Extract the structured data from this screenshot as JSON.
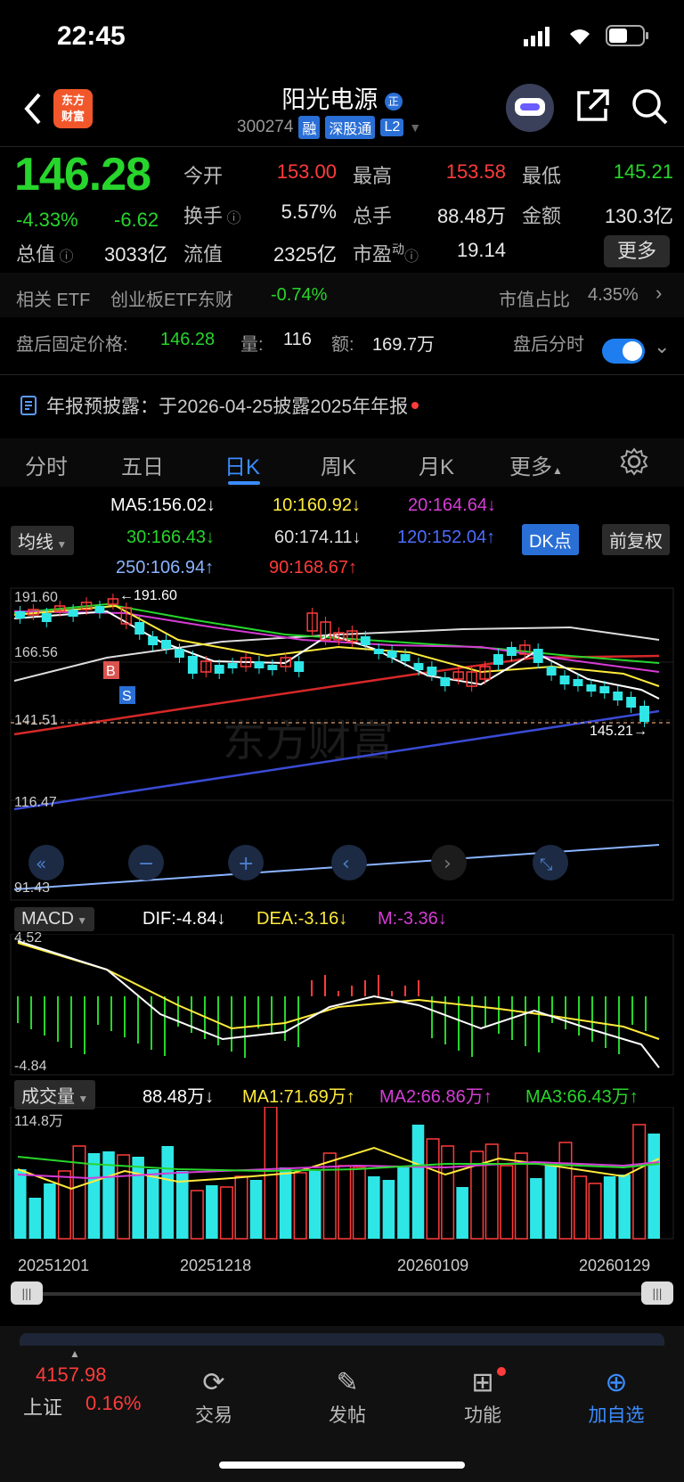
{
  "status": {
    "time": "22:45"
  },
  "header": {
    "logo_text_line1": "东方",
    "logo_text_line2": "财富",
    "name": "阳光电源",
    "badge": "正",
    "code": "300274",
    "tags": [
      "融",
      "深股通",
      "L2"
    ]
  },
  "quote": {
    "price": "146.28",
    "change_pct": "-4.33%",
    "change_abs": "-6.62",
    "fields": [
      {
        "label": "今开",
        "value": "153.00",
        "color": "red"
      },
      {
        "label": "最高",
        "value": "153.58",
        "color": "red"
      },
      {
        "label": "最低",
        "value": "145.21",
        "color": "green"
      },
      {
        "label": "换手",
        "value": "5.57%",
        "color": "white"
      },
      {
        "label": "总手",
        "value": "88.48万",
        "color": "white"
      },
      {
        "label": "金额",
        "value": "130.3亿",
        "color": "white"
      },
      {
        "label": "总值",
        "value": "3033亿",
        "color": "white"
      },
      {
        "label": "流值",
        "value": "2325亿",
        "color": "white"
      },
      {
        "label": "市盈",
        "value": "19.14",
        "color": "white"
      }
    ],
    "pe_superscript": "动",
    "more_label": "更多"
  },
  "etf": {
    "label": "相关 ETF",
    "name": "创业板ETF东财",
    "change": "-0.74%",
    "ratio_label": "市值占比",
    "ratio_value": "4.35%"
  },
  "after_hours": {
    "price_label": "盘后固定价格:",
    "price": "146.28",
    "vol_label": "量:",
    "vol": "116",
    "amt_label": "额:",
    "amt": "169.7万",
    "toggle_label": "盘后分时"
  },
  "notice": "年报预披露：于2026-04-25披露2025年年报",
  "tabs": [
    "分时",
    "五日",
    "日K",
    "周K",
    "月K",
    "更多"
  ],
  "indicators": {
    "ma_selector": "均线",
    "ma5": "MA5:156.02",
    "ma10": "10:160.92",
    "ma20": "20:164.64",
    "ma30": "30:166.43",
    "ma60": "60:174.11",
    "ma120": "120:152.04",
    "ma250": "250:106.94",
    "ma90": "90:168.67",
    "dk_button": "DK点",
    "fq_button": "前复权",
    "arrow_down": "↓",
    "arrow_up": "↑"
  },
  "price_axis": [
    "191.60",
    "166.56",
    "141.51",
    "116.47",
    "91.43"
  ],
  "annotations": {
    "high_mark": "191.60",
    "low_mark": "145.21"
  },
  "macd": {
    "selector": "MACD",
    "dif": "DIF:-4.84",
    "dea": "DEA:-3.16",
    "m": "M:-3.36",
    "axis_top": "4.52",
    "axis_bottom": "-4.84"
  },
  "volume": {
    "selector": "成交量",
    "value": "88.48万",
    "ma1": "MA1:71.69万",
    "ma2": "MA2:66.86万",
    "ma3": "MA3:66.43万",
    "axis_top": "114.8万"
  },
  "dates": [
    "20251201",
    "20251218",
    "20260109",
    "20260129"
  ],
  "nav": {
    "index_value": "4157.98",
    "index_name": "上证",
    "index_change": "0.16%",
    "items": [
      "交易",
      "发帖",
      "功能",
      "加自选"
    ]
  },
  "colors": {
    "up": "#ff3b3b",
    "down": "#27d52c",
    "accent": "#3b8cff",
    "candle_down": "#2fe6e6"
  }
}
